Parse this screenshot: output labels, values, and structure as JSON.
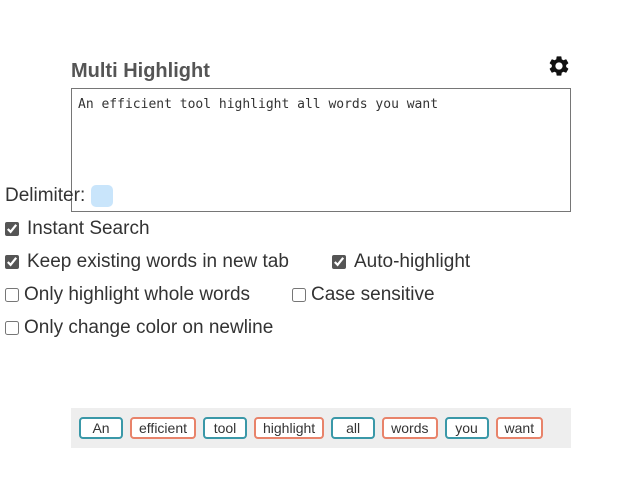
{
  "title": "Multi Highlight",
  "settings_icon": "gear-icon",
  "textarea_value": "An efficient tool highlight all words you want",
  "delimiter": {
    "label": "Delimiter:",
    "value": "",
    "color": "#c9e5fb"
  },
  "options": {
    "instant_search": {
      "label": "Instant Search",
      "checked": true
    },
    "keep_words": {
      "label": "Keep existing words in new tab",
      "checked": true
    },
    "auto_highlight": {
      "label": "Auto-highlight",
      "checked": true
    },
    "whole_words": {
      "label": "Only highlight whole words",
      "checked": false
    },
    "case_sensitive": {
      "label": "Case sensitive",
      "checked": false
    },
    "change_color_newline": {
      "label": "Only change color on newline",
      "checked": false
    }
  },
  "tag_colors": {
    "blue": "#3a98a8",
    "orange": "#e8836a"
  },
  "tags": [
    {
      "text": "An",
      "color": "blue"
    },
    {
      "text": "efficient",
      "color": "orange"
    },
    {
      "text": "tool",
      "color": "blue"
    },
    {
      "text": "highlight",
      "color": "orange"
    },
    {
      "text": "all",
      "color": "blue"
    },
    {
      "text": "words",
      "color": "orange"
    },
    {
      "text": "you",
      "color": "blue"
    },
    {
      "text": "want",
      "color": "orange"
    }
  ]
}
